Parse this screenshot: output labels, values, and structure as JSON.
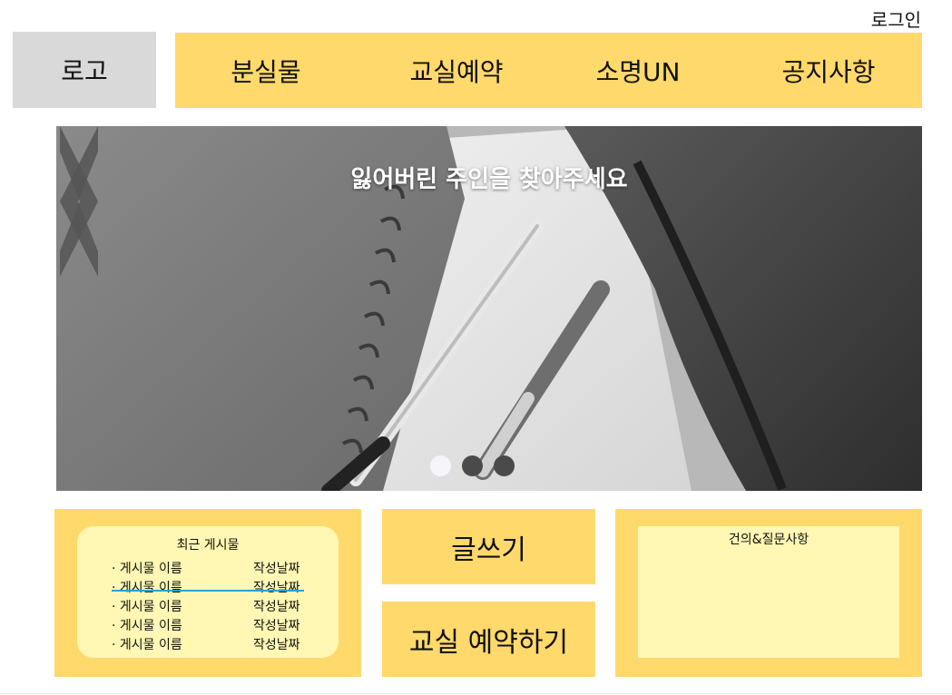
{
  "header": {
    "login_label": "로그인",
    "logo_label": "로고"
  },
  "nav": {
    "items": [
      {
        "label": "분실물"
      },
      {
        "label": "교실예약"
      },
      {
        "label": "소명UN"
      },
      {
        "label": "공지사항"
      }
    ]
  },
  "banner": {
    "title": "잃어버린 주인을 찾아주세요",
    "slide_count": 3,
    "active_slide": 1,
    "prev_icon": "chevron-left-icon",
    "next_icon": "chevron-right-icon"
  },
  "recent_posts": {
    "title": "최근 게시물",
    "rows": [
      {
        "name": "· 게시물 이름",
        "date": "작성날짜"
      },
      {
        "name": "· 게시물 이름",
        "date": "작성날짜"
      },
      {
        "name": "· 게시물 이름",
        "date": "작성날짜"
      },
      {
        "name": "· 게시물 이름",
        "date": "작성날짜"
      },
      {
        "name": "· 게시물 이름",
        "date": "작성날짜"
      }
    ]
  },
  "actions": {
    "write_label": "글쓰기",
    "reserve_label": "교실 예약하기"
  },
  "inquiry": {
    "title": "건의&질문사항"
  },
  "colors": {
    "accent": "#ffd96b",
    "panel_inner": "#fff7b3",
    "logo_bg": "#d9d9d9",
    "highlight_line": "#2aa0d8"
  }
}
